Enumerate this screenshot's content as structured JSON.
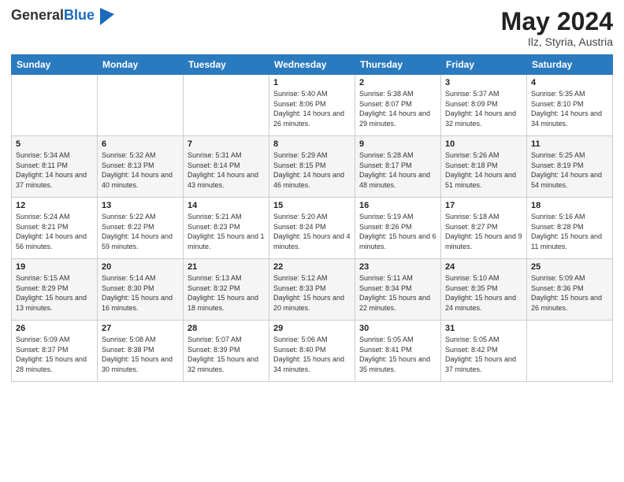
{
  "header": {
    "logo_general": "General",
    "logo_blue": "Blue",
    "month_year": "May 2024",
    "location": "Ilz, Styria, Austria"
  },
  "weekdays": [
    "Sunday",
    "Monday",
    "Tuesday",
    "Wednesday",
    "Thursday",
    "Friday",
    "Saturday"
  ],
  "weeks": [
    [
      {
        "day": "",
        "sunrise": "",
        "sunset": "",
        "daylight": ""
      },
      {
        "day": "",
        "sunrise": "",
        "sunset": "",
        "daylight": ""
      },
      {
        "day": "",
        "sunrise": "",
        "sunset": "",
        "daylight": ""
      },
      {
        "day": "1",
        "sunrise": "Sunrise: 5:40 AM",
        "sunset": "Sunset: 8:06 PM",
        "daylight": "Daylight: 14 hours and 26 minutes."
      },
      {
        "day": "2",
        "sunrise": "Sunrise: 5:38 AM",
        "sunset": "Sunset: 8:07 PM",
        "daylight": "Daylight: 14 hours and 29 minutes."
      },
      {
        "day": "3",
        "sunrise": "Sunrise: 5:37 AM",
        "sunset": "Sunset: 8:09 PM",
        "daylight": "Daylight: 14 hours and 32 minutes."
      },
      {
        "day": "4",
        "sunrise": "Sunrise: 5:35 AM",
        "sunset": "Sunset: 8:10 PM",
        "daylight": "Daylight: 14 hours and 34 minutes."
      }
    ],
    [
      {
        "day": "5",
        "sunrise": "Sunrise: 5:34 AM",
        "sunset": "Sunset: 8:11 PM",
        "daylight": "Daylight: 14 hours and 37 minutes."
      },
      {
        "day": "6",
        "sunrise": "Sunrise: 5:32 AM",
        "sunset": "Sunset: 8:13 PM",
        "daylight": "Daylight: 14 hours and 40 minutes."
      },
      {
        "day": "7",
        "sunrise": "Sunrise: 5:31 AM",
        "sunset": "Sunset: 8:14 PM",
        "daylight": "Daylight: 14 hours and 43 minutes."
      },
      {
        "day": "8",
        "sunrise": "Sunrise: 5:29 AM",
        "sunset": "Sunset: 8:15 PM",
        "daylight": "Daylight: 14 hours and 46 minutes."
      },
      {
        "day": "9",
        "sunrise": "Sunrise: 5:28 AM",
        "sunset": "Sunset: 8:17 PM",
        "daylight": "Daylight: 14 hours and 48 minutes."
      },
      {
        "day": "10",
        "sunrise": "Sunrise: 5:26 AM",
        "sunset": "Sunset: 8:18 PM",
        "daylight": "Daylight: 14 hours and 51 minutes."
      },
      {
        "day": "11",
        "sunrise": "Sunrise: 5:25 AM",
        "sunset": "Sunset: 8:19 PM",
        "daylight": "Daylight: 14 hours and 54 minutes."
      }
    ],
    [
      {
        "day": "12",
        "sunrise": "Sunrise: 5:24 AM",
        "sunset": "Sunset: 8:21 PM",
        "daylight": "Daylight: 14 hours and 56 minutes."
      },
      {
        "day": "13",
        "sunrise": "Sunrise: 5:22 AM",
        "sunset": "Sunset: 8:22 PM",
        "daylight": "Daylight: 14 hours and 59 minutes."
      },
      {
        "day": "14",
        "sunrise": "Sunrise: 5:21 AM",
        "sunset": "Sunset: 8:23 PM",
        "daylight": "Daylight: 15 hours and 1 minute."
      },
      {
        "day": "15",
        "sunrise": "Sunrise: 5:20 AM",
        "sunset": "Sunset: 8:24 PM",
        "daylight": "Daylight: 15 hours and 4 minutes."
      },
      {
        "day": "16",
        "sunrise": "Sunrise: 5:19 AM",
        "sunset": "Sunset: 8:26 PM",
        "daylight": "Daylight: 15 hours and 6 minutes."
      },
      {
        "day": "17",
        "sunrise": "Sunrise: 5:18 AM",
        "sunset": "Sunset: 8:27 PM",
        "daylight": "Daylight: 15 hours and 9 minutes."
      },
      {
        "day": "18",
        "sunrise": "Sunrise: 5:16 AM",
        "sunset": "Sunset: 8:28 PM",
        "daylight": "Daylight: 15 hours and 11 minutes."
      }
    ],
    [
      {
        "day": "19",
        "sunrise": "Sunrise: 5:15 AM",
        "sunset": "Sunset: 8:29 PM",
        "daylight": "Daylight: 15 hours and 13 minutes."
      },
      {
        "day": "20",
        "sunrise": "Sunrise: 5:14 AM",
        "sunset": "Sunset: 8:30 PM",
        "daylight": "Daylight: 15 hours and 16 minutes."
      },
      {
        "day": "21",
        "sunrise": "Sunrise: 5:13 AM",
        "sunset": "Sunset: 8:32 PM",
        "daylight": "Daylight: 15 hours and 18 minutes."
      },
      {
        "day": "22",
        "sunrise": "Sunrise: 5:12 AM",
        "sunset": "Sunset: 8:33 PM",
        "daylight": "Daylight: 15 hours and 20 minutes."
      },
      {
        "day": "23",
        "sunrise": "Sunrise: 5:11 AM",
        "sunset": "Sunset: 8:34 PM",
        "daylight": "Daylight: 15 hours and 22 minutes."
      },
      {
        "day": "24",
        "sunrise": "Sunrise: 5:10 AM",
        "sunset": "Sunset: 8:35 PM",
        "daylight": "Daylight: 15 hours and 24 minutes."
      },
      {
        "day": "25",
        "sunrise": "Sunrise: 5:09 AM",
        "sunset": "Sunset: 8:36 PM",
        "daylight": "Daylight: 15 hours and 26 minutes."
      }
    ],
    [
      {
        "day": "26",
        "sunrise": "Sunrise: 5:09 AM",
        "sunset": "Sunset: 8:37 PM",
        "daylight": "Daylight: 15 hours and 28 minutes."
      },
      {
        "day": "27",
        "sunrise": "Sunrise: 5:08 AM",
        "sunset": "Sunset: 8:38 PM",
        "daylight": "Daylight: 15 hours and 30 minutes."
      },
      {
        "day": "28",
        "sunrise": "Sunrise: 5:07 AM",
        "sunset": "Sunset: 8:39 PM",
        "daylight": "Daylight: 15 hours and 32 minutes."
      },
      {
        "day": "29",
        "sunrise": "Sunrise: 5:06 AM",
        "sunset": "Sunset: 8:40 PM",
        "daylight": "Daylight: 15 hours and 34 minutes."
      },
      {
        "day": "30",
        "sunrise": "Sunrise: 5:05 AM",
        "sunset": "Sunset: 8:41 PM",
        "daylight": "Daylight: 15 hours and 35 minutes."
      },
      {
        "day": "31",
        "sunrise": "Sunrise: 5:05 AM",
        "sunset": "Sunset: 8:42 PM",
        "daylight": "Daylight: 15 hours and 37 minutes."
      },
      {
        "day": "",
        "sunrise": "",
        "sunset": "",
        "daylight": ""
      }
    ]
  ]
}
